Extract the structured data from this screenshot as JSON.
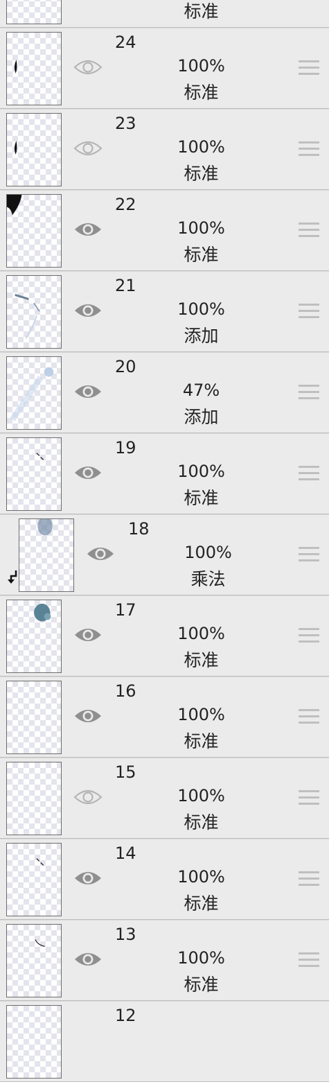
{
  "layers": [
    {
      "number": "",
      "opacity": "",
      "mode": "标准",
      "visible": true,
      "partial": true
    },
    {
      "number": "24",
      "opacity": "100%",
      "mode": "标准",
      "visible": false,
      "art": "stroke-small"
    },
    {
      "number": "23",
      "opacity": "100%",
      "mode": "标准",
      "visible": false,
      "art": "stroke-small"
    },
    {
      "number": "22",
      "opacity": "100%",
      "mode": "标准",
      "visible": true,
      "art": "hair-corner"
    },
    {
      "number": "21",
      "opacity": "100%",
      "mode": "添加",
      "visible": true,
      "art": "light-lines"
    },
    {
      "number": "20",
      "opacity": "47%",
      "mode": "添加",
      "visible": true,
      "art": "blue-glow"
    },
    {
      "number": "19",
      "opacity": "100%",
      "mode": "标准",
      "visible": true,
      "art": "tiny-marks"
    },
    {
      "number": "18",
      "opacity": "100%",
      "mode": "乘法",
      "visible": true,
      "clipped": true,
      "art": "blue-shadow"
    },
    {
      "number": "17",
      "opacity": "100%",
      "mode": "标准",
      "visible": true,
      "art": "teal-blob"
    },
    {
      "number": "16",
      "opacity": "100%",
      "mode": "标准",
      "visible": true,
      "art": "none"
    },
    {
      "number": "15",
      "opacity": "100%",
      "mode": "标准",
      "visible": false,
      "art": "none"
    },
    {
      "number": "14",
      "opacity": "100%",
      "mode": "标准",
      "visible": true,
      "art": "tiny-marks"
    },
    {
      "number": "13",
      "opacity": "100%",
      "mode": "标准",
      "visible": true,
      "art": "small-arc"
    },
    {
      "number": "12",
      "opacity": "",
      "mode": "",
      "visible": true,
      "partial": true
    }
  ],
  "icons": {
    "visible": "eye-icon",
    "hidden": "eye-outline-icon",
    "handle": "drag-handle-icon",
    "clip": "clipping-arrow-icon"
  },
  "colors": {
    "row_bg": "#ebebeb",
    "eye_visible": "#8f8f8f",
    "eye_hidden": "#b5b5b5",
    "handle": "#bfbfbf"
  }
}
